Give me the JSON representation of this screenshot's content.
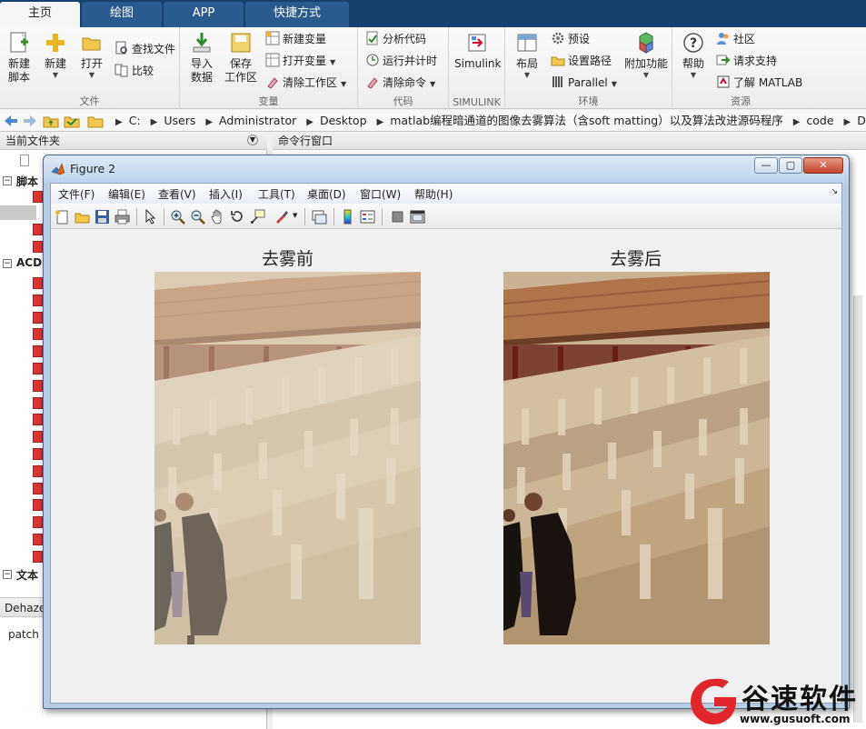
{
  "ribbon": {
    "tabs": [
      {
        "label": "主页",
        "active": true
      },
      {
        "label": "绘图",
        "active": false
      },
      {
        "label": "APP",
        "active": false
      },
      {
        "label": "快捷方式",
        "active": false
      }
    ],
    "file_group": {
      "label": "文件",
      "new_script": "新建\n脚本",
      "new": "新建",
      "open": "打开",
      "find_files": "查找文件",
      "compare": "比较"
    },
    "variable_group": {
      "label": "变量",
      "import": "导入\n数据",
      "save_workspace": "保存\n工作区",
      "new_variable": "新建变量",
      "open_variable": "打开变量",
      "clear_workspace": "清除工作区"
    },
    "code_group": {
      "label": "代码",
      "analyze": "分析代码",
      "run_time": "运行并计时",
      "clear_commands": "清除命令"
    },
    "simulink_group": {
      "label": "SIMULINK",
      "simulink": "Simulink"
    },
    "env_group": {
      "label": "环境",
      "layout": "布局",
      "preferences": "预设",
      "set_path": "设置路径",
      "parallel": "Parallel",
      "addons": "附加功能"
    },
    "resources_group": {
      "label": "资源",
      "help": "帮助",
      "community": "社区",
      "request_support": "请求支持",
      "learn_matlab": "了解 MATLAB"
    }
  },
  "address": {
    "crumbs": [
      "C:",
      "Users",
      "Administrator",
      "Desktop",
      "matlab编程暗通道的图像去雾算法（含soft matting）以及算法改进源码程序",
      "code",
      "DeHaze"
    ]
  },
  "panels": {
    "current_folder": "当前文件夹",
    "command_window": "命令行窗口",
    "tree_scripts": "脚本",
    "tree_acds": "ACDS",
    "tree_text": "文本",
    "bottom_tab": "Dehaze",
    "bottom_text": "patch"
  },
  "figure": {
    "title": "Figure 2",
    "menu": [
      "文件(F)",
      "编辑(E)",
      "查看(V)",
      "插入(I)",
      "工具(T)",
      "桌面(D)",
      "窗口(W)",
      "帮助(H)"
    ],
    "axes1_title": "去雾前",
    "axes2_title": "去雾后"
  },
  "watermark": {
    "brand": "谷速软件",
    "url": "www.gusuoft.com",
    "color": "#e0262b"
  },
  "colors": {
    "tabbar": "#16406e",
    "accent_red": "#e0262b",
    "window_frame": "#b6cde3"
  }
}
